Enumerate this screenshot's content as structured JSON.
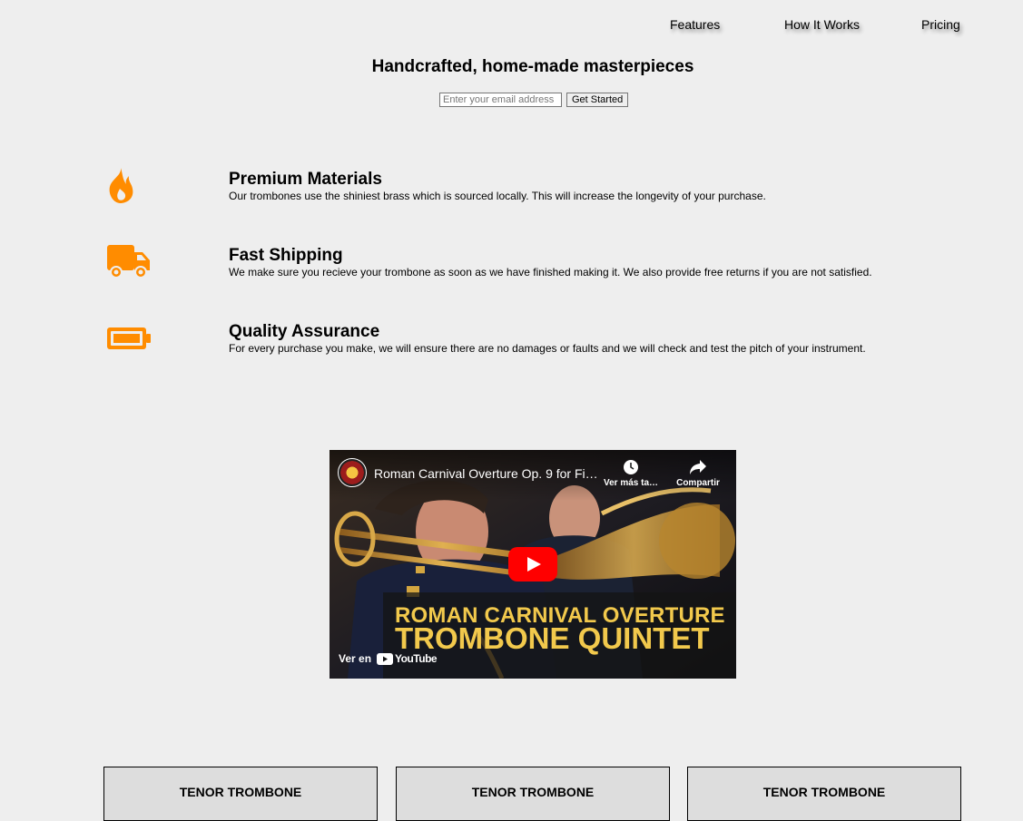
{
  "nav": {
    "features": "Features",
    "how_it_works": "How It Works",
    "pricing": "Pricing"
  },
  "hero": {
    "title": "Handcrafted, home-made masterpieces",
    "email_placeholder": "Enter your email address",
    "button_label": "Get Started"
  },
  "features": [
    {
      "icon": "fire-icon",
      "title": "Premium Materials",
      "text": "Our trombones use the shiniest brass which is sourced locally. This will increase the longevity of your purchase."
    },
    {
      "icon": "truck-icon",
      "title": "Fast Shipping",
      "text": "We make sure you recieve your trombone as soon as we have finished making it. We also provide free returns if you are not satisfied."
    },
    {
      "icon": "battery-icon",
      "title": "Quality Assurance",
      "text": "For every purchase you make, we will ensure there are no damages or faults and we will check and test the pitch of your instrument."
    }
  ],
  "video": {
    "title": "Roman Carnival Overture Op. 9 for Fi…",
    "watch_later": "Ver más ta…",
    "share": "Compartir",
    "overlay_line1": "ROMAN CARNIVAL OVERTURE",
    "overlay_line2": "TROMBONE QUINTET",
    "watch_on": "Ver en",
    "youtube_wordmark": "YouTube"
  },
  "cards": [
    {
      "title": "TENOR TROMBONE"
    },
    {
      "title": "TENOR TROMBONE"
    },
    {
      "title": "TENOR TROMBONE"
    }
  ],
  "colors": {
    "background": "#eeeeee",
    "accent_orange": "#ff8c00",
    "youtube_red": "#ff0000",
    "overlay_yellow": "#f2c94c"
  }
}
